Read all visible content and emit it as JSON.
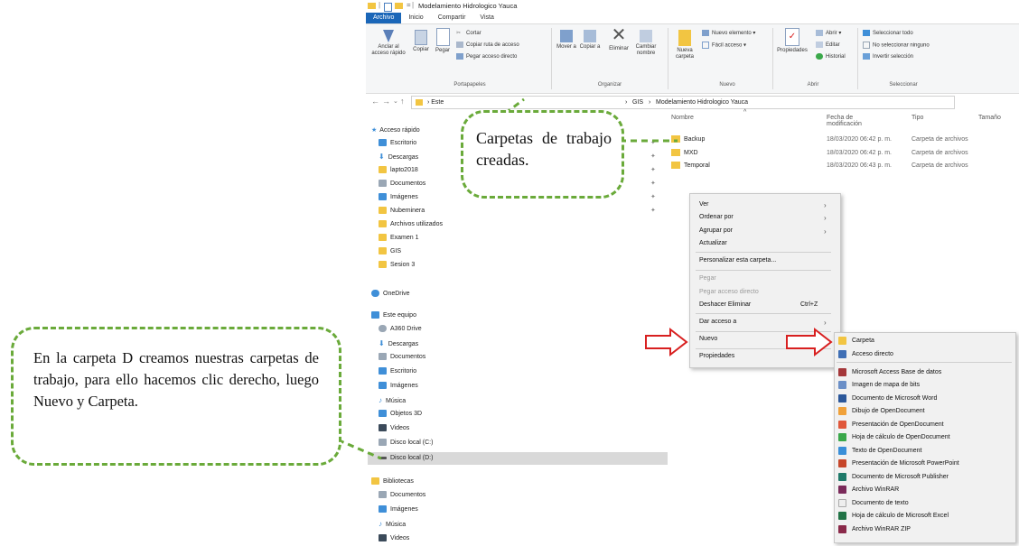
{
  "window": {
    "title": "Modelamiento Hidrologico Yauca",
    "tabs": [
      "Archivo",
      "Inicio",
      "Compartir",
      "Vista"
    ]
  },
  "ribbon": {
    "portapapeles": {
      "group_label": "Portapapeles",
      "anclar": "Anclar al acceso rápido",
      "copiar": "Copiar",
      "pegar": "Pegar",
      "cortar": "Cortar",
      "copiar_ruta": "Copiar ruta de acceso",
      "pegar_acceso": "Pegar acceso directo"
    },
    "organizar": {
      "group_label": "Organizar",
      "mover": "Mover a",
      "copiar_a": "Copiar a",
      "eliminar": "Eliminar",
      "cambiar": "Cambiar nombre"
    },
    "nuevo": {
      "group_label": "Nuevo",
      "nueva_carpeta": "Nueva carpeta",
      "nuevo_elemento": "Nuevo elemento",
      "facil_acceso": "Fácil acceso"
    },
    "abrir": {
      "group_label": "Abrir",
      "propiedades": "Propiedades",
      "abrir": "Abrir",
      "editar": "Editar",
      "historial": "Historial"
    },
    "seleccionar": {
      "group_label": "Seleccionar",
      "todo": "Seleccionar todo",
      "ninguno": "No seleccionar ninguno",
      "invertir": "Invertir selección"
    }
  },
  "address": {
    "part1": "Este",
    "part2": "GIS",
    "part3": "Modelamiento Hidrologico Yauca"
  },
  "nav": {
    "quick": "Acceso rápido",
    "quick_items": [
      "Escritorio",
      "Descargas",
      "lapto2018",
      "Documentos",
      "Imágenes",
      "Nubeminera",
      "Archivos utilizados",
      "Examen 1",
      "GIS",
      "Sesion 3"
    ],
    "onedrive": "OneDrive",
    "pc": "Este equipo",
    "pc_items": [
      "A360 Drive",
      "Descargas",
      "Documentos",
      "Escritorio",
      "Imágenes",
      "Música",
      "Objetos 3D",
      "Videos",
      "Disco local (C:)",
      "Disco local (D:)"
    ],
    "libraries": "Bibliotecas",
    "lib_items": [
      "Documentos",
      "Imágenes",
      "Música",
      "Videos"
    ]
  },
  "columns": {
    "name": "Nombre",
    "date": "Fecha de modificación",
    "type": "Tipo",
    "size": "Tamaño"
  },
  "files": [
    {
      "name": "Backup",
      "date": "18/03/2020 06:42 p. m.",
      "type": "Carpeta de archivos"
    },
    {
      "name": "MXD",
      "date": "18/03/2020 06:42 p. m.",
      "type": "Carpeta de archivos"
    },
    {
      "name": "Temporal",
      "date": "18/03/2020 06:43 p. m.",
      "type": "Carpeta de archivos"
    }
  ],
  "context_menu": {
    "ver": "Ver",
    "ordenar": "Ordenar por",
    "agrupar": "Agrupar por",
    "actualizar": "Actualizar",
    "personalizar": "Personalizar esta carpeta...",
    "pegar": "Pegar",
    "pegar_acceso": "Pegar acceso directo",
    "deshacer": "Deshacer Eliminar",
    "deshacer_shortcut": "Ctrl+Z",
    "dar_acceso": "Dar acceso a",
    "nuevo": "Nuevo",
    "propiedades": "Propiedades"
  },
  "submenu": [
    {
      "label": "Carpeta",
      "color": "#f2c542"
    },
    {
      "label": "Acceso directo",
      "color": "#3f6fb5"
    },
    {
      "label": "Microsoft Access Base de datos",
      "color": "#a4373a"
    },
    {
      "label": "Imagen de mapa de bits",
      "color": "#6b8fc7"
    },
    {
      "label": "Documento de Microsoft Word",
      "color": "#2b579a"
    },
    {
      "label": "Dibujo de OpenDocument",
      "color": "#f0a13a"
    },
    {
      "label": "Presentación de OpenDocument",
      "color": "#e0573a"
    },
    {
      "label": "Hoja de cálculo de OpenDocument",
      "color": "#3aa84a"
    },
    {
      "label": "Texto de OpenDocument",
      "color": "#3a8fd8"
    },
    {
      "label": "Presentación de Microsoft PowerPoint",
      "color": "#c6462a"
    },
    {
      "label": "Documento de Microsoft Publisher",
      "color": "#1f7a6a"
    },
    {
      "label": "Archivo WinRAR",
      "color": "#7a2a5a"
    },
    {
      "label": "Documento de texto",
      "color": "#dddddd"
    },
    {
      "label": "Hoja de cálculo de Microsoft Excel",
      "color": "#217346"
    },
    {
      "label": "Archivo WinRAR ZIP",
      "color": "#8a2a4a"
    }
  ],
  "callouts": {
    "top": "Carpetas de trabajo creadas.",
    "left": "En la carpeta D creamos nuestras carpetas de trabajo, para ello hacemos clic derecho, luego Nuevo y Carpeta."
  },
  "colors": {
    "accent": "#1a66b8",
    "callout_border": "#6aaa3a",
    "arrow": "#d82020"
  }
}
